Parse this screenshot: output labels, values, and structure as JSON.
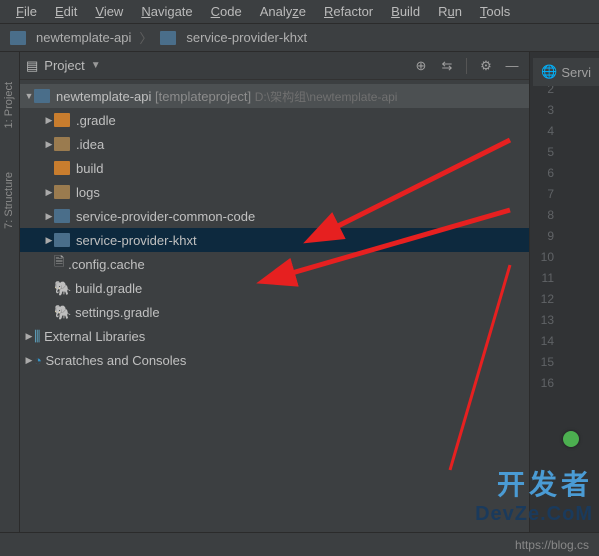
{
  "menubar": [
    {
      "label": "File",
      "m": "F"
    },
    {
      "label": "Edit",
      "m": "E"
    },
    {
      "label": "View",
      "m": "V"
    },
    {
      "label": "Navigate",
      "m": "N"
    },
    {
      "label": "Code",
      "m": "C"
    },
    {
      "label": "Analyze",
      "m": "z"
    },
    {
      "label": "Refactor",
      "m": "R"
    },
    {
      "label": "Build",
      "m": "B"
    },
    {
      "label": "Run",
      "m": "u"
    },
    {
      "label": "Tools",
      "m": "T"
    }
  ],
  "breadcrumb": {
    "root": "newtemplate-api",
    "child": "service-provider-khxt"
  },
  "side_tabs": {
    "one": "1: Project",
    "two": "7: Structure"
  },
  "tool_window": {
    "title": "Project"
  },
  "tree": {
    "root": {
      "name": "newtemplate-api",
      "branch": "[templateproject]",
      "path": "D:\\架构组\\newtemplate-api"
    },
    "children": [
      {
        "name": ".gradle",
        "kind": "folder-orange",
        "expandable": true
      },
      {
        "name": ".idea",
        "kind": "folder",
        "expandable": true
      },
      {
        "name": "build",
        "kind": "folder-orange",
        "expandable": false
      },
      {
        "name": "logs",
        "kind": "folder",
        "expandable": true
      },
      {
        "name": "service-provider-common-code",
        "kind": "module",
        "expandable": true
      },
      {
        "name": "service-provider-khxt",
        "kind": "module",
        "expandable": true,
        "selected": true
      },
      {
        "name": ".config.cache",
        "kind": "file",
        "expandable": false
      },
      {
        "name": "build.gradle",
        "kind": "gradle",
        "expandable": false
      },
      {
        "name": "settings.gradle",
        "kind": "gradle",
        "expandable": false
      }
    ],
    "ext1": "External Libraries",
    "ext2": "Scratches and Consoles"
  },
  "gutter_lines": 16,
  "services_tab": "Servi",
  "statusbar": "https://blog.cs",
  "watermark": {
    "cn": "开发者",
    "en": "DevZe.CoM"
  }
}
